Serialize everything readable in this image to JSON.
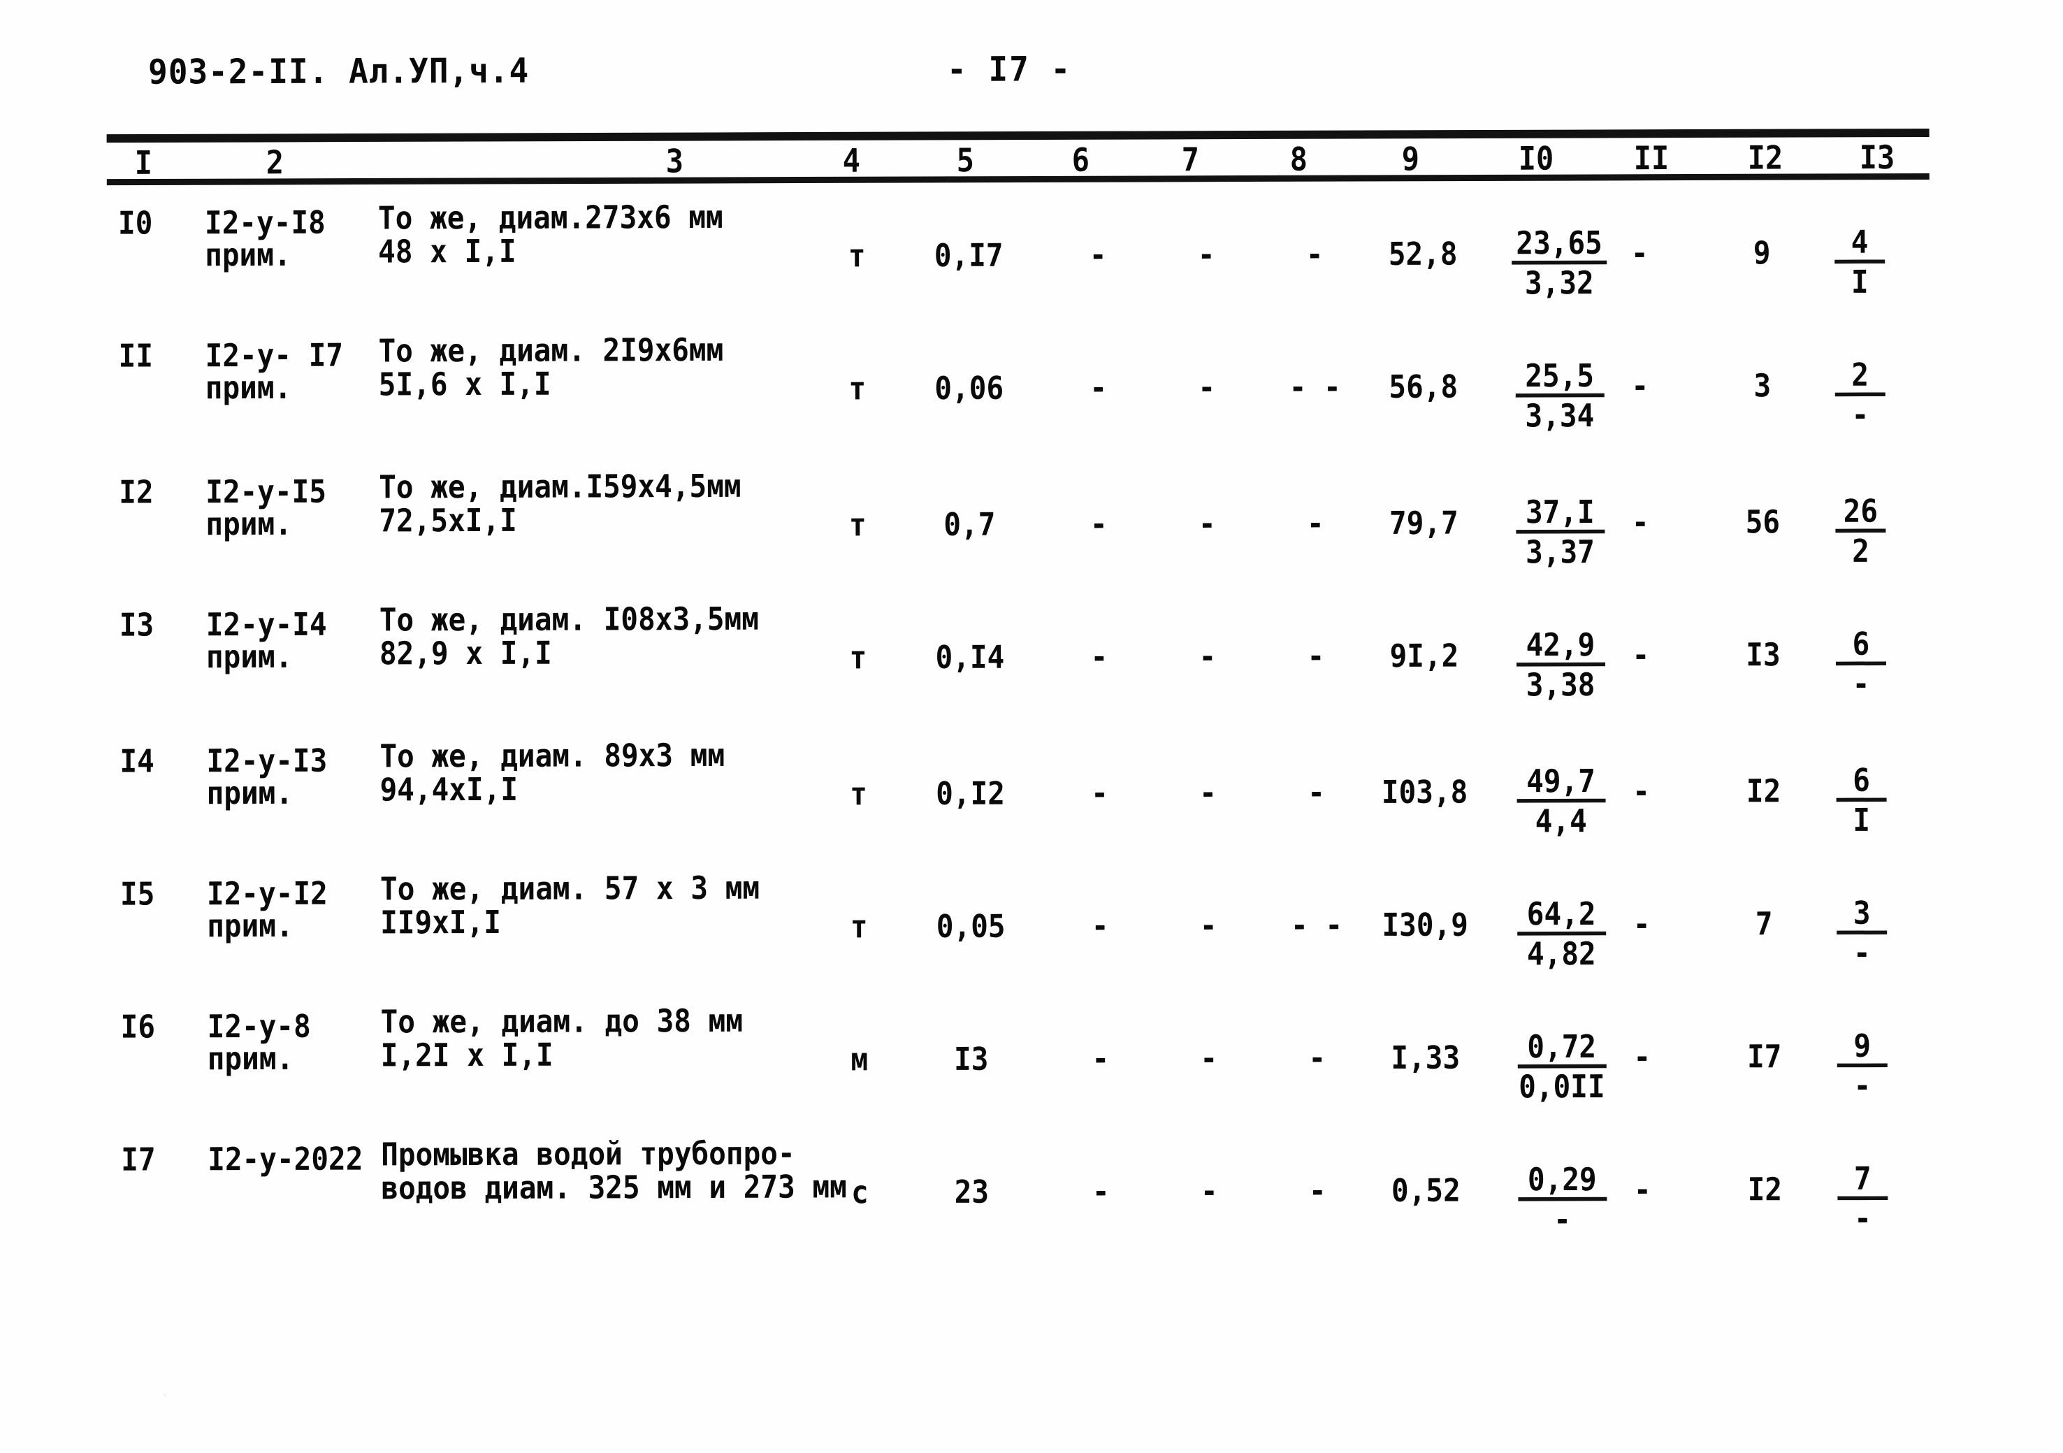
{
  "header": {
    "document_code": "903-2-II. Ал.УП,ч.4",
    "page_number": "- I7 -"
  },
  "table": {
    "column_headers": [
      "I",
      "2",
      "3",
      "4",
      "5",
      "6",
      "7",
      "8",
      "9",
      "I0",
      "II",
      "I2",
      "I3"
    ],
    "rows": [
      {
        "num": "I0",
        "code": "I2-у-I8",
        "code2": "прим.",
        "desc": "То же, диам.273х6 мм",
        "desc2": "48 х I,I",
        "unit": "т",
        "c5": "0,I7",
        "c6": "-",
        "c7": "-",
        "c8": "-",
        "c9": "52,8",
        "c10_num": "23,65",
        "c10_den": "3,32",
        "c11": "-",
        "c12": "9",
        "c13_num": "4",
        "c13_den": "I"
      },
      {
        "num": "II",
        "code": "I2-у- I7",
        "code2": "прим.",
        "desc": "То же, диам. 2I9х6мм",
        "desc2": "5I,6 х I,I",
        "unit": "т",
        "c5": "0,06",
        "c6": "-",
        "c7": "-",
        "c8": "- -",
        "c9": "56,8",
        "c10_num": "25,5",
        "c10_den": "3,34",
        "c11": "-",
        "c12": "3",
        "c13_num": "2",
        "c13_den": "-"
      },
      {
        "num": "I2",
        "code": "I2-у-I5",
        "code2": "прим.",
        "desc": "То же, диам.I59х4,5мм",
        "desc2": "72,5хI,I",
        "unit": "т",
        "c5": "0,7",
        "c6": "-",
        "c7": "-",
        "c8": "-",
        "c9": "79,7",
        "c10_num": "37,I",
        "c10_den": "3,37",
        "c11": "-",
        "c12": "56",
        "c13_num": "26",
        "c13_den": "2"
      },
      {
        "num": "I3",
        "code": "I2-у-I4",
        "code2": "прим.",
        "desc": "То же, диам. I08х3,5мм",
        "desc2": "82,9 х I,I",
        "unit": "т",
        "c5": "0,I4",
        "c6": "-",
        "c7": "-",
        "c8": "-",
        "c9": "9I,2",
        "c10_num": "42,9",
        "c10_den": "3,38",
        "c11": "-",
        "c12": "I3",
        "c13_num": "6",
        "c13_den": "-"
      },
      {
        "num": "I4",
        "code": "I2-у-I3",
        "code2": "прим.",
        "desc": "То же, диам. 89х3 мм",
        "desc2": "94,4хI,I",
        "unit": "т",
        "c5": "0,I2",
        "c6": "-",
        "c7": "-",
        "c8": "-",
        "c9": "I03,8",
        "c10_num": "49,7",
        "c10_den": "4,4",
        "c11": "-",
        "c12": "I2",
        "c13_num": "6",
        "c13_den": "I"
      },
      {
        "num": "I5",
        "code": "I2-у-I2",
        "code2": "прим.",
        "desc": "То же, диам. 57 х 3 мм",
        "desc2": "II9хI,I",
        "unit": "т",
        "c5": "0,05",
        "c6": "-",
        "c7": "-",
        "c8": "- -",
        "c9": "I30,9",
        "c10_num": "64,2",
        "c10_den": "4,82",
        "c11": "-",
        "c12": "7",
        "c13_num": "3",
        "c13_den": "-"
      },
      {
        "num": "I6",
        "code": "I2-у-8",
        "code2": "прим.",
        "desc": "То же, диам. до 38 мм",
        "desc2": "I,2I х I,I",
        "unit": "м",
        "c5": "I3",
        "c6": "-",
        "c7": "-",
        "c8": "-",
        "c9": "I,33",
        "c10_num": "0,72",
        "c10_den": "0,0II",
        "c11": "-",
        "c12": "I7",
        "c13_num": "9",
        "c13_den": "-"
      },
      {
        "num": "I7",
        "code": "I2-у-2022",
        "code2": "",
        "desc": "Промывка водой трубопро-",
        "desc2": "водов диам. 325 мм и 273 мм",
        "unit": "с",
        "c5": "23",
        "c6": "-",
        "c7": "-",
        "c8": "-",
        "c9": "0,52",
        "c10_num": "0,29",
        "c10_den": "-",
        "c11": "-",
        "c12": "I2",
        "c13_num": "7",
        "c13_den": "-"
      }
    ]
  }
}
